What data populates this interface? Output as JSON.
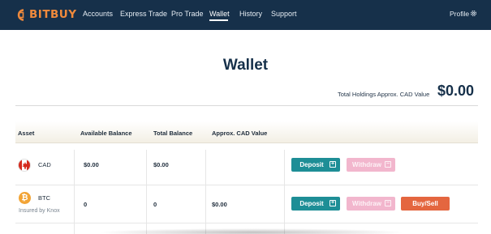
{
  "nav": {
    "brand": "BITBUY",
    "items": [
      {
        "label": "Accounts"
      },
      {
        "label": "Express Trade"
      },
      {
        "label": "Pro Trade"
      },
      {
        "label": "Wallet",
        "active": true
      },
      {
        "label": "History"
      },
      {
        "label": "Support"
      }
    ],
    "profile": "Profile",
    "colors": {
      "bg": "#16304a",
      "brand": "#f08a3c"
    }
  },
  "page": {
    "title": "Wallet",
    "holdings_label": "Total Holdings Approx. CAD Value",
    "holdings_value": "$0.00"
  },
  "table": {
    "headers": [
      "Asset",
      "Available Balance",
      "Total Balance",
      "Approx. CAD Value"
    ],
    "rows": [
      {
        "asset": "CAD",
        "icon": "canada-flag-icon",
        "available": "$0.00",
        "total": "$0.00",
        "cad_value": "",
        "actions": [
          "Deposit",
          "Withdraw"
        ]
      },
      {
        "asset": "BTC",
        "note": "Insured by Knox",
        "icon": "bitcoin-icon",
        "available": "0",
        "total": "0",
        "cad_value": "$0.00",
        "actions": [
          "Deposit",
          "Withdraw",
          "Buy/Sell"
        ]
      }
    ]
  },
  "colors": {
    "deposit": "#1e8e96",
    "withdraw": "#f2b6cd",
    "buysell": "#e4663f"
  }
}
